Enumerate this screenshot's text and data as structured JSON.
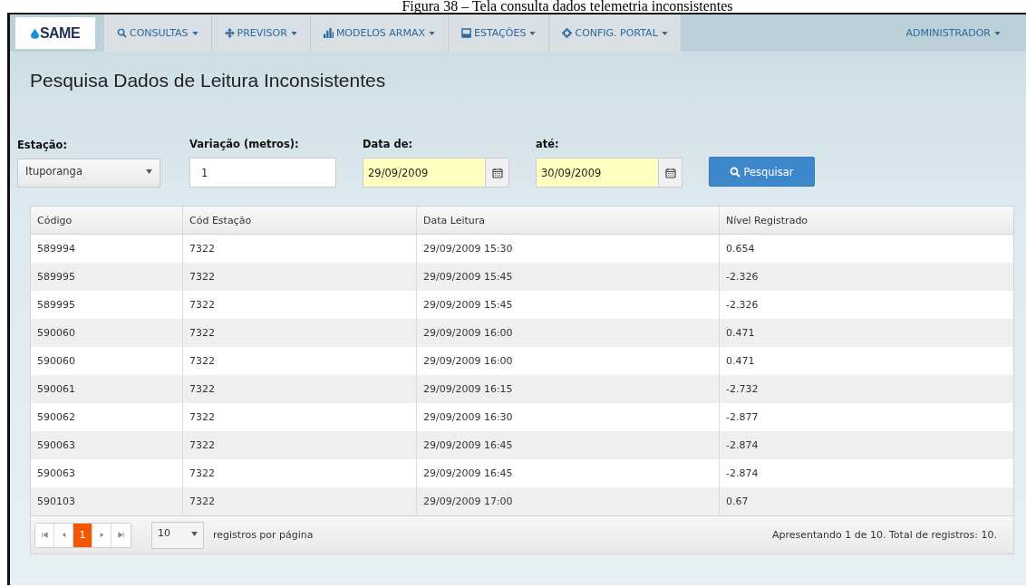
{
  "caption": "Figura 38 – Tela consulta dados telemetria inconsistentes",
  "navbar": {
    "logo": "SAME",
    "items": [
      {
        "label": "CONSULTAS"
      },
      {
        "label": "PREVISOR"
      },
      {
        "label": "MODELOS ARMAX"
      },
      {
        "label": "ESTAÇÕES"
      },
      {
        "label": "CONFIG. PORTAL"
      }
    ],
    "user": "ADMINISTRADOR"
  },
  "page_title": "Pesquisa Dados de Leitura Inconsistentes",
  "form": {
    "station": {
      "label": "Estação:",
      "value": "Ituporanga"
    },
    "variation": {
      "label": "Variação (metros):",
      "value": "1"
    },
    "date_from": {
      "label": "Data de:",
      "value": "29/09/2009"
    },
    "date_to": {
      "label": "até:",
      "value": "30/09/2009"
    },
    "search_button": "Pesquisar"
  },
  "table": {
    "columns": [
      "Código",
      "Cód Estação",
      "Data Leitura",
      "Nível Registrado"
    ],
    "rows": [
      [
        "589994",
        "7322",
        "29/09/2009 15:30",
        "0.654"
      ],
      [
        "589995",
        "7322",
        "29/09/2009 15:45",
        "-2.326"
      ],
      [
        "589995",
        "7322",
        "29/09/2009 15:45",
        "-2.326"
      ],
      [
        "590060",
        "7322",
        "29/09/2009 16:00",
        "0.471"
      ],
      [
        "590060",
        "7322",
        "29/09/2009 16:00",
        "0.471"
      ],
      [
        "590061",
        "7322",
        "29/09/2009 16:15",
        "-2.732"
      ],
      [
        "590062",
        "7322",
        "29/09/2009 16:30",
        "-2.877"
      ],
      [
        "590063",
        "7322",
        "29/09/2009 16:45",
        "-2.874"
      ],
      [
        "590063",
        "7322",
        "29/09/2009 16:45",
        "-2.874"
      ],
      [
        "590103",
        "7322",
        "29/09/2009 17:00",
        "0.67"
      ]
    ]
  },
  "pager": {
    "buttons": [
      {
        "kind": "first",
        "selected": false
      },
      {
        "kind": "prev",
        "selected": false
      },
      {
        "kind": "page",
        "label": "1",
        "selected": true
      },
      {
        "kind": "next",
        "selected": false
      },
      {
        "kind": "last",
        "selected": false
      }
    ],
    "page_size": "10",
    "page_size_label": "registros por página",
    "summary": "Apresentando 1 de 10. Total de registros: 10."
  }
}
